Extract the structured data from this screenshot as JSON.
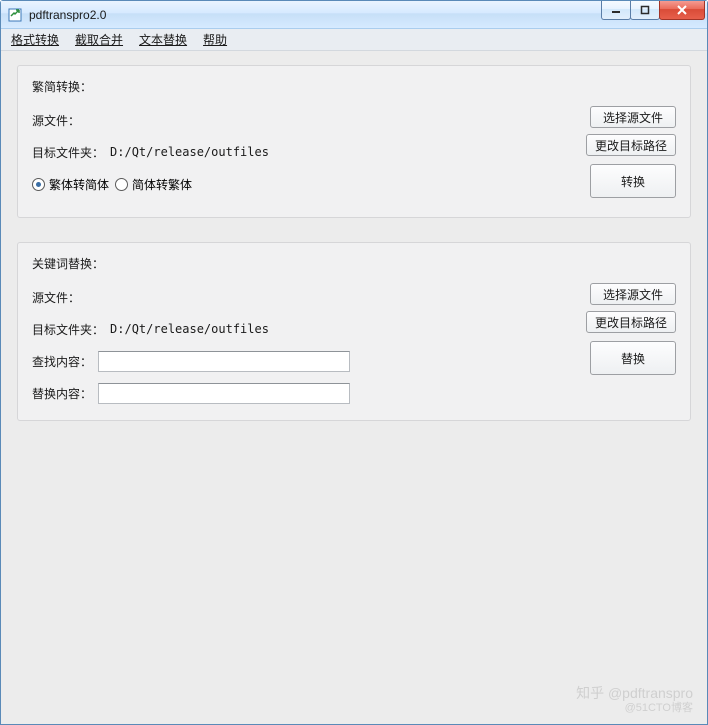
{
  "window": {
    "title": "pdftranspro2.0",
    "app_icon": "app-icon"
  },
  "menubar": {
    "items": [
      "格式转换",
      "截取合并",
      "文本替换",
      "帮助"
    ]
  },
  "panel_tradsimp": {
    "title": "繁简转换：",
    "source_label": "源文件：",
    "source_value": "",
    "target_label": "目标文件夹：",
    "target_value": "D:/Qt/release/outfiles",
    "btn_select_source": "选择源文件",
    "btn_change_target": "更改目标路径",
    "radio_t2s": "繁体转简体",
    "radio_s2t": "简体转繁体",
    "radio_checked": "t2s",
    "btn_convert": "转换"
  },
  "panel_keyword": {
    "title": "关键词替换：",
    "source_label": "源文件：",
    "source_value": "",
    "target_label": "目标文件夹：",
    "target_value": "D:/Qt/release/outfiles",
    "btn_select_source": "选择源文件",
    "btn_change_target": "更改目标路径",
    "find_label": "查找内容：",
    "find_value": "",
    "replace_label": "替换内容：",
    "replace_value": "",
    "btn_replace": "替换"
  },
  "watermark": {
    "line1": "知乎 @pdftranspro",
    "line2": "@51CTO博客"
  }
}
